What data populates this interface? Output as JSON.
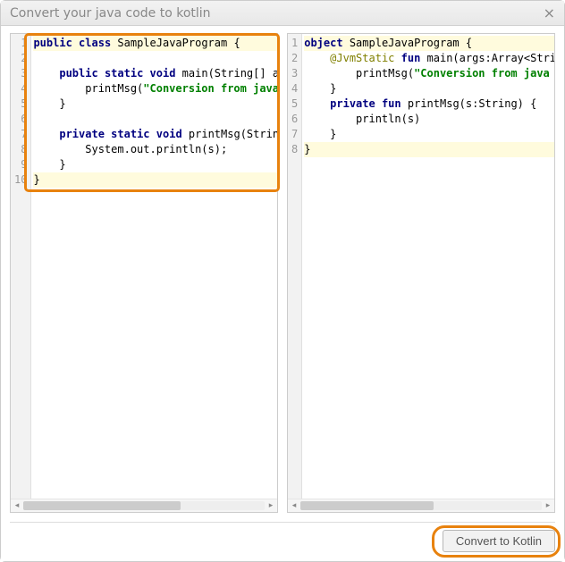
{
  "window": {
    "title": "Convert your java code to kotlin"
  },
  "left": {
    "lineCount": 10,
    "lines": [
      {
        "hl": true,
        "tokens": [
          {
            "t": "public",
            "c": "kw"
          },
          {
            "t": " "
          },
          {
            "t": "class",
            "c": "kw"
          },
          {
            "t": " SampleJavaProgram {"
          }
        ]
      },
      {
        "tokens": [
          {
            "t": ""
          }
        ]
      },
      {
        "tokens": [
          {
            "t": "    "
          },
          {
            "t": "public",
            "c": "kw"
          },
          {
            "t": " "
          },
          {
            "t": "static",
            "c": "kw"
          },
          {
            "t": " "
          },
          {
            "t": "void",
            "c": "kw"
          },
          {
            "t": " main(String[] args){"
          }
        ]
      },
      {
        "tokens": [
          {
            "t": "        printMsg("
          },
          {
            "t": "\"Conversion from java file to kotlin\"",
            "c": "str"
          },
          {
            "t": ");"
          }
        ]
      },
      {
        "tokens": [
          {
            "t": "    }"
          }
        ]
      },
      {
        "tokens": [
          {
            "t": ""
          }
        ]
      },
      {
        "tokens": [
          {
            "t": "    "
          },
          {
            "t": "private",
            "c": "kw"
          },
          {
            "t": " "
          },
          {
            "t": "static",
            "c": "kw"
          },
          {
            "t": " "
          },
          {
            "t": "void",
            "c": "kw"
          },
          {
            "t": " printMsg(String s) {"
          }
        ]
      },
      {
        "tokens": [
          {
            "t": "        System.out.println(s);"
          }
        ]
      },
      {
        "tokens": [
          {
            "t": "    }"
          }
        ]
      },
      {
        "hl": true,
        "tokens": [
          {
            "t": "}"
          }
        ]
      }
    ]
  },
  "right": {
    "lineCount": 8,
    "lines": [
      {
        "hl": true,
        "tokens": [
          {
            "t": "object",
            "c": "kw"
          },
          {
            "t": " SampleJavaProgram {"
          }
        ]
      },
      {
        "tokens": [
          {
            "t": "    "
          },
          {
            "t": "@JvmStatic",
            "c": "ann"
          },
          {
            "t": " "
          },
          {
            "t": "fun",
            "c": "kw"
          },
          {
            "t": " main(args:Array<String>) {"
          }
        ]
      },
      {
        "tokens": [
          {
            "t": "        printMsg("
          },
          {
            "t": "\"Conversion from java file to kotlin\"",
            "c": "str"
          },
          {
            "t": ")"
          }
        ]
      },
      {
        "tokens": [
          {
            "t": "    }"
          }
        ]
      },
      {
        "tokens": [
          {
            "t": "    "
          },
          {
            "t": "private",
            "c": "kw"
          },
          {
            "t": " "
          },
          {
            "t": "fun",
            "c": "kw"
          },
          {
            "t": " printMsg(s:String) {"
          }
        ]
      },
      {
        "tokens": [
          {
            "t": "        println(s)"
          }
        ]
      },
      {
        "tokens": [
          {
            "t": "    }"
          }
        ]
      },
      {
        "hl": true,
        "tokens": [
          {
            "t": "}"
          }
        ]
      }
    ]
  },
  "footer": {
    "convert_label": "Convert to Kotlin"
  }
}
